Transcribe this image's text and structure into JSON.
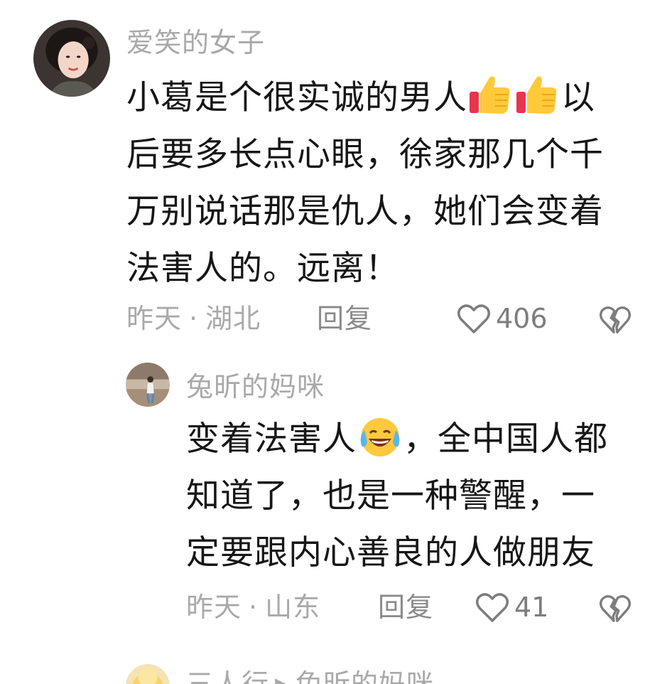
{
  "comments": [
    {
      "username": "爱笑的女子",
      "text_lines": [
        "小葛是个很实诚的男人",
        "后要多长点心眼，徐家那几个千",
        "万别说话那是仇人，她们会变着",
        "法害人的。远离！"
      ],
      "line1_after_emoji": "以",
      "emoji_1": "thumbs-up-emoji",
      "time": "昨天",
      "separator": "·",
      "location": "湖北",
      "reply_label": "回复",
      "likes": "406",
      "like_icon": "heart-outline-icon",
      "dislike_icon": "broken-heart-icon"
    },
    {
      "username": "兔昕的妈咪",
      "text_lines": [
        "变着法害人",
        "，全中国人都",
        "知道了，也是一种警醒，一",
        "定要跟内心善良的人做朋友"
      ],
      "emoji_1": "crying-laughing-emoji",
      "time": "昨天",
      "separator": "·",
      "location": "山东",
      "reply_label": "回复",
      "likes": "41",
      "like_icon": "heart-outline-icon",
      "dislike_icon": "broken-heart-icon"
    },
    {
      "username": "三人行",
      "reply_arrow": "▶",
      "reply_to": "兔昕的妈咪"
    }
  ],
  "colors": {
    "text": "#161616",
    "meta": "#a9a9a9",
    "icon": "#7d7d7d",
    "background": "#ffffff"
  }
}
